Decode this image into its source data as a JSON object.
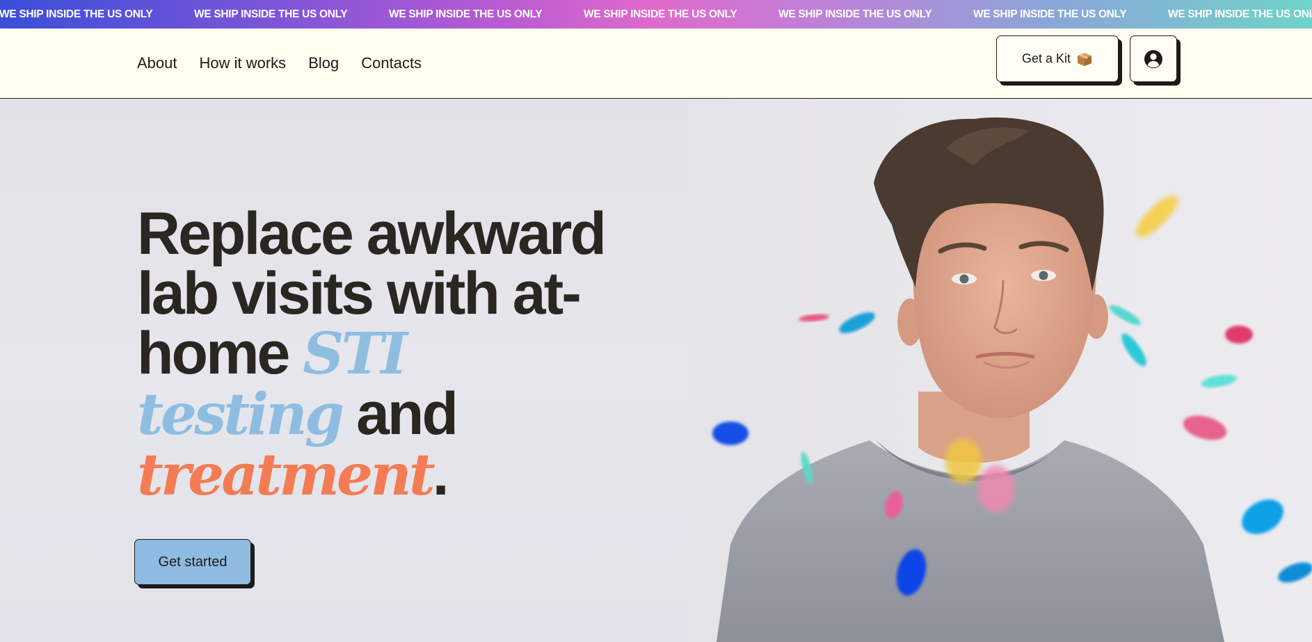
{
  "banner": {
    "text": "WE SHIP INSIDE THE US ONLY",
    "icon": "us-flag-icon",
    "repeats": [
      "WE SHIP INSIDE THE US ONLY",
      "WE SHIP INSIDE THE US ONLY",
      "WE SHIP INSIDE THE US ONLY",
      "WE SHIP INSIDE THE US ONLY",
      "WE SHIP INSIDE THE US ONLY",
      "WE SHIP INSIDE THE US ONLY",
      "WE SHIP INSIDE THE US ONLY",
      "WE SHIP INSIDE THE US ONLY"
    ]
  },
  "nav": {
    "links": [
      "About",
      "How it works",
      "Blog",
      "Contacts"
    ],
    "kit_button": {
      "label": "Get a Kit",
      "icon": "package-box-icon"
    },
    "account_button": {
      "icon": "user-account-icon"
    }
  },
  "hero": {
    "headline_part1": "Replace awkward lab visits with at-home ",
    "headline_highlight1": "STI testing",
    "headline_part2": " and ",
    "headline_highlight2": "treatment",
    "headline_end": ".",
    "cta_label": "Get started",
    "image": "young-man-confetti-photo"
  },
  "colors": {
    "accent_blue": "#8fbde2",
    "accent_orange": "#f47c55",
    "nav_background": "#fdfdf0",
    "ink": "#1d1b18",
    "cta_background": "#8ebbe1"
  }
}
